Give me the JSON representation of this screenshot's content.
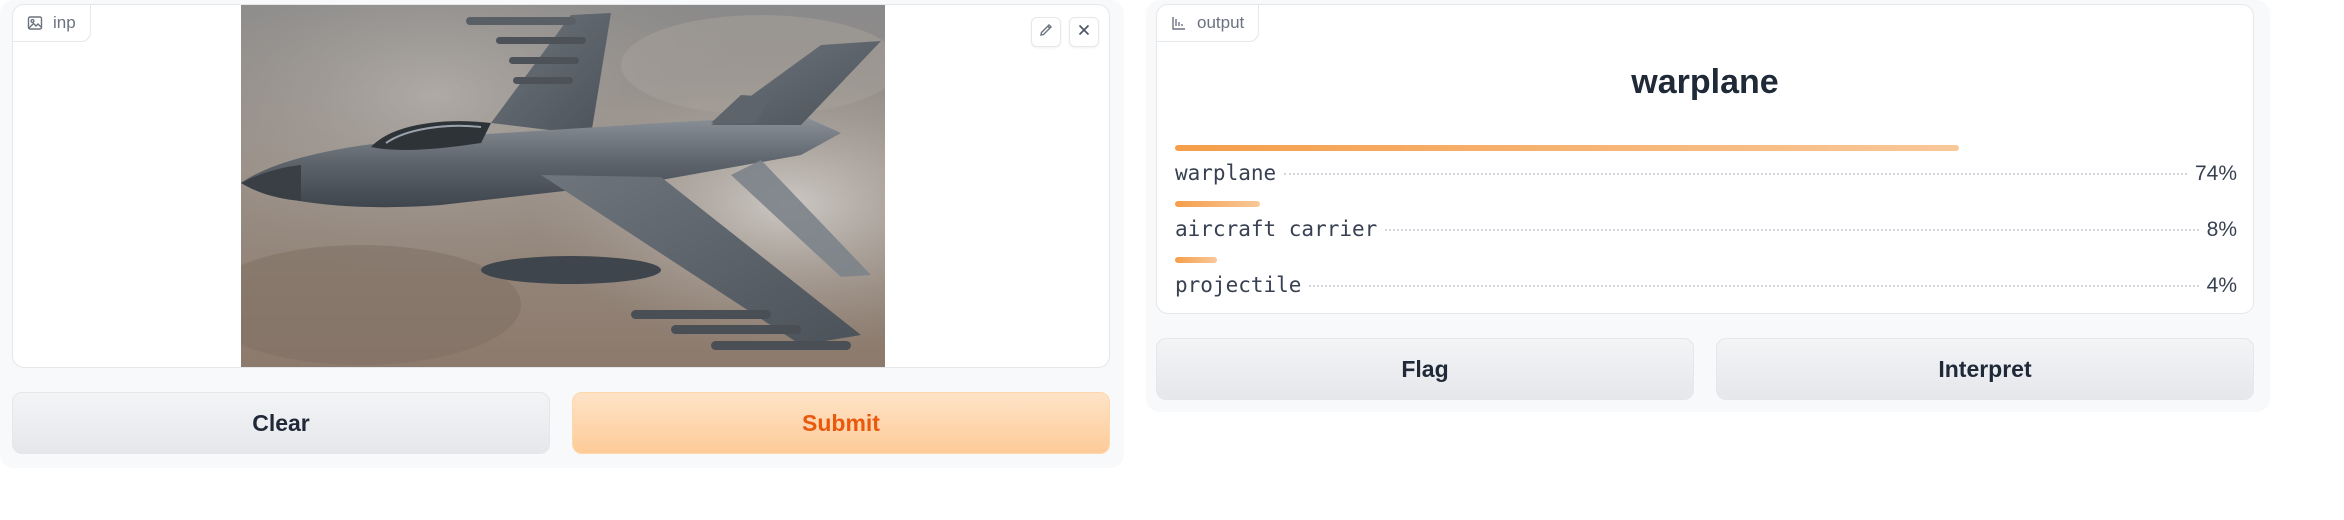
{
  "input": {
    "label": "inp",
    "icon": "image-icon",
    "actions": [
      {
        "icon": "pencil-icon"
      },
      {
        "icon": "close-icon"
      }
    ]
  },
  "buttons": {
    "clear": "Clear",
    "submit": "Submit",
    "flag": "Flag",
    "interpret": "Interpret"
  },
  "output": {
    "label": "output",
    "icon": "bar-chart-icon",
    "prediction": "warplane",
    "confidences": [
      {
        "label": "warplane",
        "value": "74%",
        "fraction": 0.74
      },
      {
        "label": "aircraft carrier",
        "value": "8%",
        "fraction": 0.08
      },
      {
        "label": "projectile",
        "value": "4%",
        "fraction": 0.04
      }
    ]
  },
  "colors": {
    "accent": "#f59e4a",
    "primary_text": "#ea580c"
  }
}
